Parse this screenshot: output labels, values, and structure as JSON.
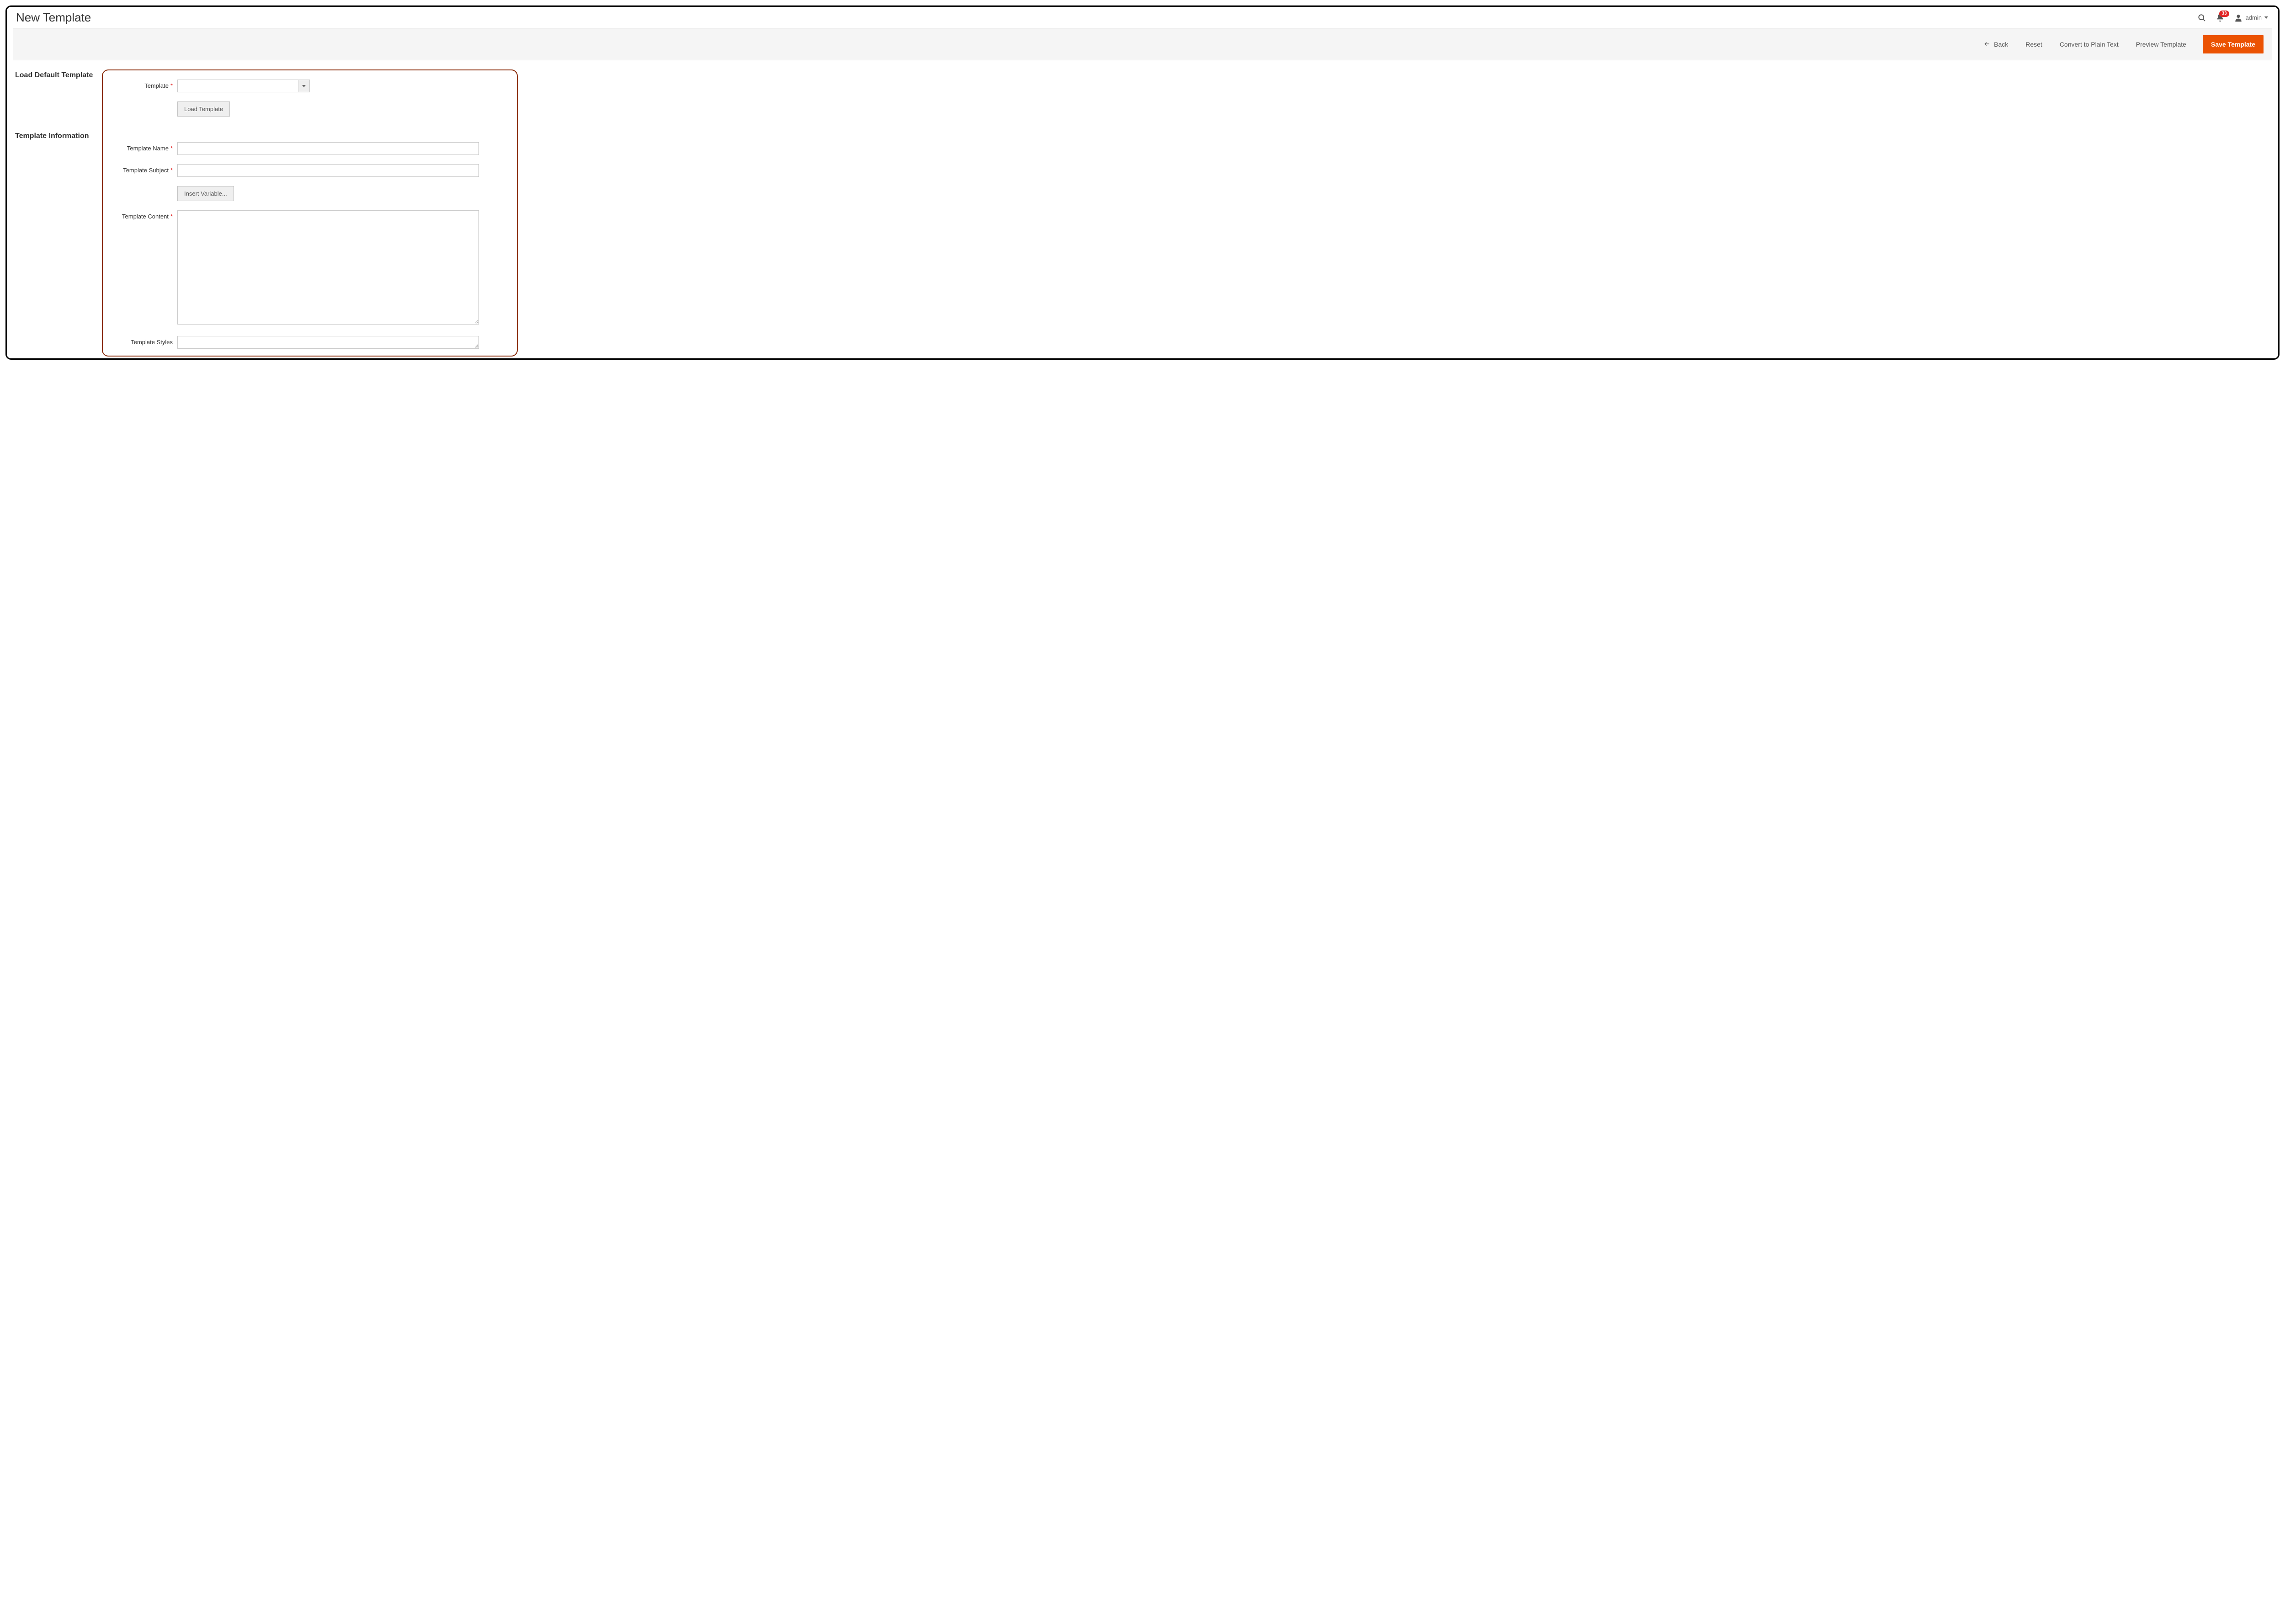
{
  "page_title": "New Template",
  "header": {
    "notification_count": "33",
    "username": "admin"
  },
  "actions": {
    "back": "Back",
    "reset": "Reset",
    "convert": "Convert to Plain Text",
    "preview": "Preview Template",
    "save": "Save Template"
  },
  "sections": {
    "load_default": "Load Default Template",
    "template_info": "Template Information"
  },
  "form": {
    "template": {
      "label": "Template",
      "value": "",
      "load_button": "Load Template"
    },
    "template_name": {
      "label": "Template Name",
      "value": ""
    },
    "template_subject": {
      "label": "Template Subject",
      "value": ""
    },
    "insert_variable": "Insert Variable...",
    "template_content": {
      "label": "Template Content",
      "value": ""
    },
    "template_styles": {
      "label": "Template Styles",
      "value": ""
    }
  },
  "colors": {
    "accent": "#eb5202",
    "danger": "#e22626",
    "highlight_border": "#8a2b0a"
  }
}
